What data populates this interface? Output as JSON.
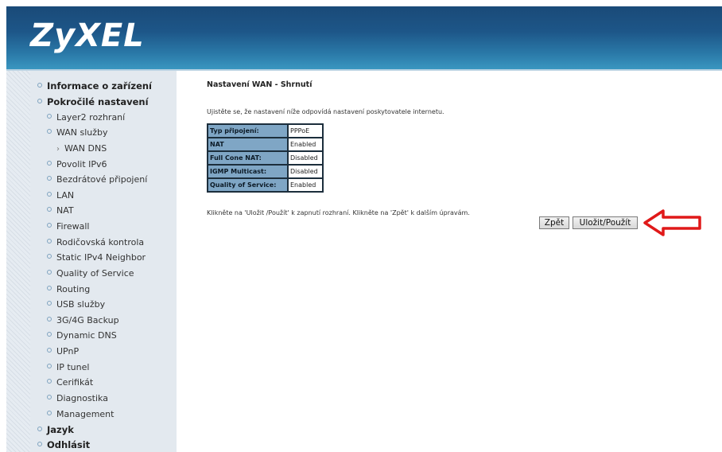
{
  "header": {
    "logo": "ZyXEL"
  },
  "sidebar": {
    "items": [
      {
        "label": "Informace o zařízení",
        "level": 0
      },
      {
        "label": "Pokročilé nastavení",
        "level": 0
      },
      {
        "label": "Layer2 rozhraní",
        "level": 1
      },
      {
        "label": "WAN služby",
        "level": 1
      },
      {
        "label": "WAN DNS",
        "level": 2
      },
      {
        "label": "Povolit IPv6",
        "level": 1
      },
      {
        "label": "Bezdrátové připojení",
        "level": 1
      },
      {
        "label": "LAN",
        "level": 1
      },
      {
        "label": "NAT",
        "level": 1
      },
      {
        "label": "Firewall",
        "level": 1
      },
      {
        "label": "Rodičovská kontrola",
        "level": 1
      },
      {
        "label": "Static IPv4 Neighbor",
        "level": 1
      },
      {
        "label": "Quality of Service",
        "level": 1
      },
      {
        "label": "Routing",
        "level": 1
      },
      {
        "label": "USB služby",
        "level": 1
      },
      {
        "label": "3G/4G Backup",
        "level": 1
      },
      {
        "label": "Dynamic DNS",
        "level": 1
      },
      {
        "label": "UPnP",
        "level": 1
      },
      {
        "label": "IP tunel",
        "level": 1
      },
      {
        "label": "Cerifikát",
        "level": 1
      },
      {
        "label": "Diagnostika",
        "level": 1
      },
      {
        "label": "Management",
        "level": 1
      },
      {
        "label": "Jazyk",
        "level": 0
      },
      {
        "label": "Odhlásit",
        "level": 0
      }
    ]
  },
  "main": {
    "title": "Nastavení WAN - Shrnutí",
    "description": "Ujistěte se, že nastavení níže odpovídá nastavení poskytovatele internetu.",
    "summary": [
      {
        "key": "Typ připojení:",
        "value": "PPPoE"
      },
      {
        "key": "NAT",
        "value": "Enabled"
      },
      {
        "key": "Full Cone NAT:",
        "value": "Disabled"
      },
      {
        "key": "IGMP Multicast:",
        "value": "Disabled"
      },
      {
        "key": "Quality of Service:",
        "value": "Enabled"
      }
    ],
    "note": "Klikněte na 'Uložit /Použít' k zapnutí rozhraní. Klikněte na 'Zpět' k dalším úpravám.",
    "back_label": "Zpět",
    "save_label": "Uložit/Použít"
  },
  "colors": {
    "header": "#1d5688",
    "table_key_bg": "#7fa6c5",
    "arrow": "#e01919"
  },
  "icons": {
    "arrow": "red-arrow-left-icon"
  }
}
